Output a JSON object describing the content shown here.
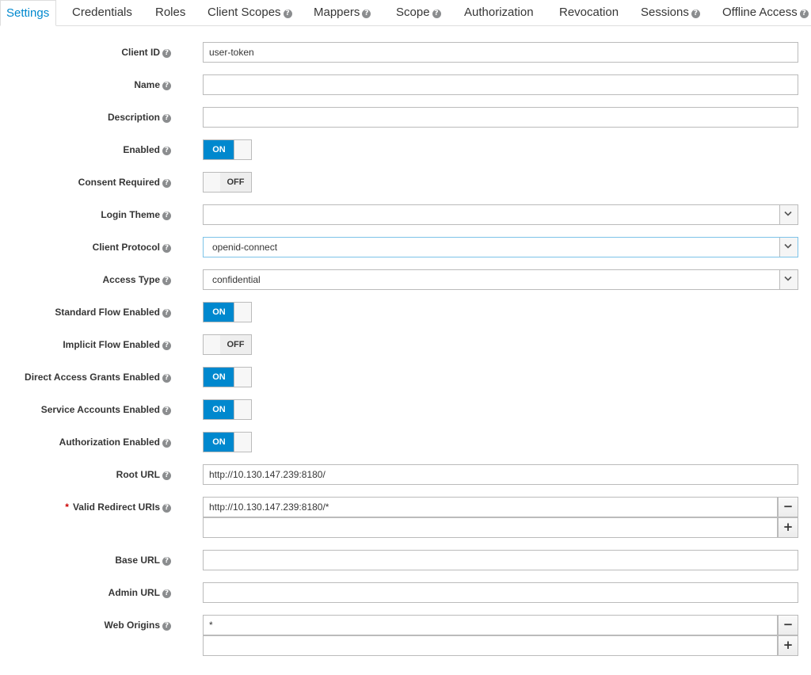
{
  "tabs": [
    {
      "label": "Settings",
      "help": false,
      "active": true
    },
    {
      "label": "Credentials",
      "help": false
    },
    {
      "label": "Roles",
      "help": false
    },
    {
      "label": "Client Scopes",
      "help": true
    },
    {
      "label": "Mappers",
      "help": true
    },
    {
      "label": "Scope",
      "help": true
    },
    {
      "label": "Authorization",
      "help": false
    },
    {
      "label": "Revocation",
      "help": false
    },
    {
      "label": "Sessions",
      "help": true
    },
    {
      "label": "Offline Access",
      "help": true
    }
  ],
  "help_glyph": "?",
  "required_mark": "*",
  "toggle_on": "ON",
  "toggle_off": "OFF",
  "add_glyph": "+",
  "remove_glyph": "−",
  "fields": {
    "client_id": {
      "label": "Client ID",
      "value": "user-token"
    },
    "name": {
      "label": "Name",
      "value": ""
    },
    "description": {
      "label": "Description",
      "value": ""
    },
    "enabled": {
      "label": "Enabled",
      "state": "ON"
    },
    "consent_required": {
      "label": "Consent Required",
      "state": "OFF"
    },
    "login_theme": {
      "label": "Login Theme",
      "value": ""
    },
    "client_protocol": {
      "label": "Client Protocol",
      "value": "openid-connect"
    },
    "access_type": {
      "label": "Access Type",
      "value": "confidential"
    },
    "standard_flow": {
      "label": "Standard Flow Enabled",
      "state": "ON"
    },
    "implicit_flow": {
      "label": "Implicit Flow Enabled",
      "state": "OFF"
    },
    "direct_access": {
      "label": "Direct Access Grants Enabled",
      "state": "ON"
    },
    "service_accounts": {
      "label": "Service Accounts Enabled",
      "state": "ON"
    },
    "authorization": {
      "label": "Authorization Enabled",
      "state": "ON"
    },
    "root_url": {
      "label": "Root URL",
      "value": "http://10.130.147.239:8180/"
    },
    "redirect_uris": {
      "label": "Valid Redirect URIs",
      "value": "http://10.130.147.239:8180/*",
      "new_value": ""
    },
    "base_url": {
      "label": "Base URL",
      "value": ""
    },
    "admin_url": {
      "label": "Admin URL",
      "value": ""
    },
    "web_origins": {
      "label": "Web Origins",
      "value": "*",
      "new_value": ""
    }
  },
  "colors": {
    "accent": "#0088ce",
    "required": "#cc0000",
    "help_icon": "#8b8d8f"
  }
}
